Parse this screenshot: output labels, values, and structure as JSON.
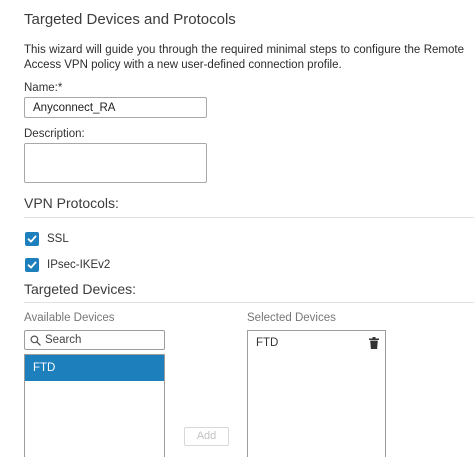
{
  "header": {
    "title": "Targeted Devices and Protocols",
    "intro": "This wizard will guide you through the required minimal steps to configure the Remote Access VPN policy with a new user-defined connection profile."
  },
  "form": {
    "name_label": "Name:*",
    "name_value": "Anyconnect_RA",
    "description_label": "Description:",
    "description_value": ""
  },
  "vpn": {
    "title": "VPN Protocols:",
    "protocols": [
      {
        "label": "SSL",
        "checked": true
      },
      {
        "label": "IPsec-IKEv2",
        "checked": true
      }
    ]
  },
  "devices": {
    "title": "Targeted Devices:",
    "available_label": "Available Devices",
    "search_placeholder": "Search",
    "available": [
      "FTD"
    ],
    "add_label": "Add",
    "selected_label": "Selected Devices",
    "selected": [
      "FTD"
    ]
  },
  "colors": {
    "accent": "#1e7fbd"
  },
  "icons": {
    "search": "search-icon",
    "checkbox": "checkmark-icon",
    "delete": "trash-icon"
  }
}
